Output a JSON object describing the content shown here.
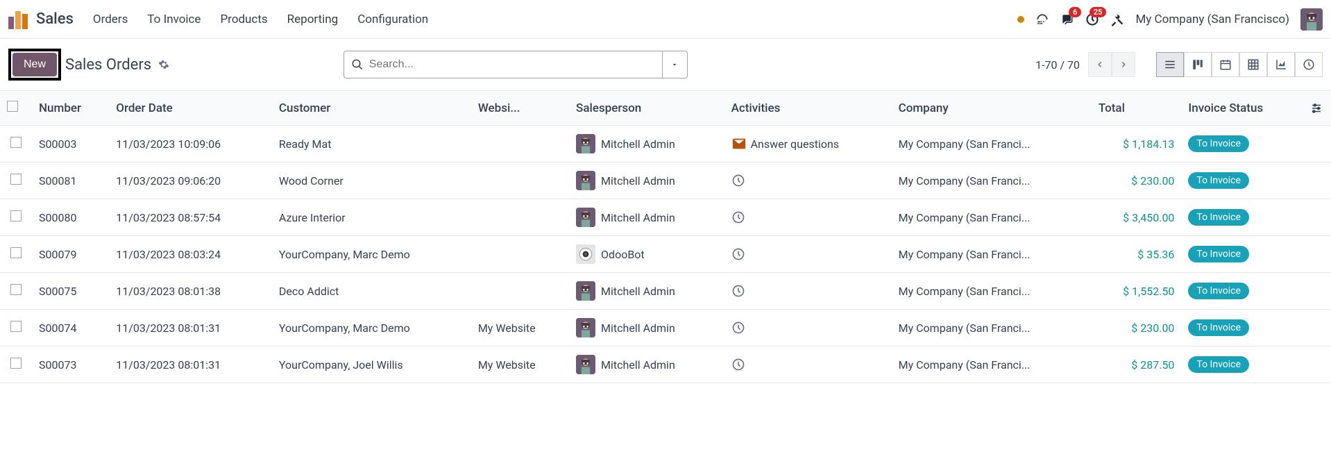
{
  "top": {
    "app_title": "Sales",
    "nav": [
      "Orders",
      "To Invoice",
      "Products",
      "Reporting",
      "Configuration"
    ],
    "badges": {
      "messages": "6",
      "activities": "25"
    },
    "company": "My Company (San Francisco)"
  },
  "control": {
    "new_label": "New",
    "breadcrumb": "Sales Orders",
    "search_placeholder": "Search...",
    "pager": "1-70 / 70"
  },
  "table": {
    "headers": {
      "number": "Number",
      "order_date": "Order Date",
      "customer": "Customer",
      "website": "Websi...",
      "salesperson": "Salesperson",
      "activities": "Activities",
      "company": "Company",
      "total": "Total",
      "invoice_status": "Invoice Status"
    },
    "rows": [
      {
        "number": "S00003",
        "date": "11/03/2023 10:09:06",
        "customer": "Ready Mat",
        "website": "",
        "salesperson": "Mitchell Admin",
        "sp_type": "admin",
        "activity_icon": "envelope",
        "activity_text": "Answer questions",
        "company": "My Company (San Franci...",
        "total": "$ 1,184.13",
        "status": "To Invoice"
      },
      {
        "number": "S00081",
        "date": "11/03/2023 09:06:20",
        "customer": "Wood Corner",
        "website": "",
        "salesperson": "Mitchell Admin",
        "sp_type": "admin",
        "activity_icon": "clock",
        "activity_text": "",
        "company": "My Company (San Franci...",
        "total": "$ 230.00",
        "status": "To Invoice"
      },
      {
        "number": "S00080",
        "date": "11/03/2023 08:57:54",
        "customer": "Azure Interior",
        "website": "",
        "salesperson": "Mitchell Admin",
        "sp_type": "admin",
        "activity_icon": "clock",
        "activity_text": "",
        "company": "My Company (San Franci...",
        "total": "$ 3,450.00",
        "status": "To Invoice"
      },
      {
        "number": "S00079",
        "date": "11/03/2023 08:03:24",
        "customer": "YourCompany, Marc Demo",
        "website": "",
        "salesperson": "OdooBot",
        "sp_type": "bot",
        "activity_icon": "clock",
        "activity_text": "",
        "company": "My Company (San Franci...",
        "total": "$ 35.36",
        "status": "To Invoice"
      },
      {
        "number": "S00075",
        "date": "11/03/2023 08:01:38",
        "customer": "Deco Addict",
        "website": "",
        "salesperson": "Mitchell Admin",
        "sp_type": "admin",
        "activity_icon": "clock",
        "activity_text": "",
        "company": "My Company (San Franci...",
        "total": "$ 1,552.50",
        "status": "To Invoice"
      },
      {
        "number": "S00074",
        "date": "11/03/2023 08:01:31",
        "customer": "YourCompany, Marc Demo",
        "website": "My Website",
        "salesperson": "Mitchell Admin",
        "sp_type": "admin",
        "activity_icon": "clock",
        "activity_text": "",
        "company": "My Company (San Franci...",
        "total": "$ 230.00",
        "status": "To Invoice"
      },
      {
        "number": "S00073",
        "date": "11/03/2023 08:01:31",
        "customer": "YourCompany, Joel Willis",
        "website": "My Website",
        "salesperson": "Mitchell Admin",
        "sp_type": "admin",
        "activity_icon": "clock",
        "activity_text": "",
        "company": "My Company (San Franci...",
        "total": "$ 287.50",
        "status": "To Invoice"
      }
    ]
  }
}
